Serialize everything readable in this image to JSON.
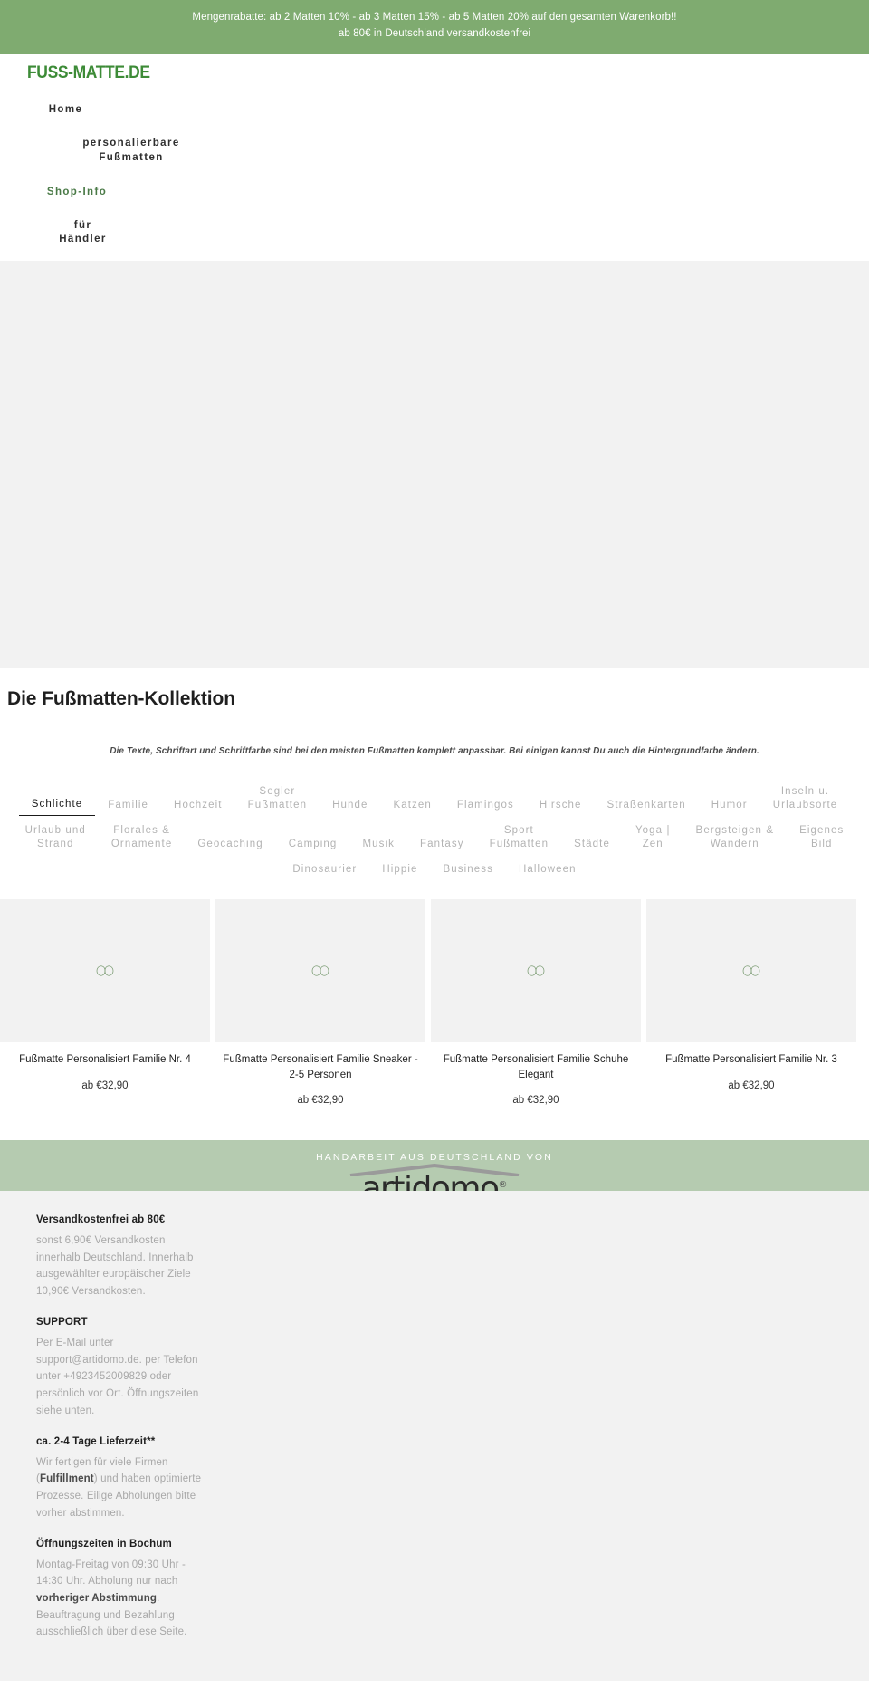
{
  "announcement": {
    "line1": "Mengenrabatte: ab 2 Matten 10% - ab 3 Matten 15% - ab 5 Matten 20% auf den gesamten Warenkorb!!",
    "line2": "ab 80€ in Deutschland versandkostenfrei"
  },
  "header": {
    "logo": "FUSS-MATTE.DE",
    "nav": [
      {
        "line1": "Home",
        "line2": ""
      },
      {
        "line1": "personalierbare",
        "line2": "Fußmatten"
      },
      {
        "line1": "Shop-Info",
        "line2": ""
      },
      {
        "line1": "für",
        "line2": "Händler"
      }
    ]
  },
  "collection": {
    "title": "Die Fußmatten-Kollektion",
    "subtitle": "Die Texte, Schriftart und Schriftfarbe sind bei den meisten Fußmatten komplett anpassbar. Bei einigen kannst Du auch die Hintergrundfarbe ändern.",
    "filters": [
      {
        "label": "Schlichte",
        "active": true
      },
      {
        "label": "Familie",
        "active": false
      },
      {
        "label": "Hochzeit",
        "active": false
      },
      {
        "label": "Segler\nFußmatten",
        "active": false
      },
      {
        "label": "Hunde",
        "active": false
      },
      {
        "label": "Katzen",
        "active": false
      },
      {
        "label": "Flamingos",
        "active": false
      },
      {
        "label": "Hirsche",
        "active": false
      },
      {
        "label": "Straßenkarten",
        "active": false
      },
      {
        "label": "Humor",
        "active": false
      },
      {
        "label": "Inseln u.\nUrlaubsorte",
        "active": false
      },
      {
        "label": "Urlaub und\nStrand",
        "active": false
      },
      {
        "label": "Florales &\nOrnamente",
        "active": false
      },
      {
        "label": "Geocaching",
        "active": false
      },
      {
        "label": "Camping",
        "active": false
      },
      {
        "label": "Musik",
        "active": false
      },
      {
        "label": "Fantasy",
        "active": false
      },
      {
        "label": "Sport\nFußmatten",
        "active": false
      },
      {
        "label": "Städte",
        "active": false
      },
      {
        "label": "Yoga |\nZen",
        "active": false
      },
      {
        "label": "Bergsteigen &\nWandern",
        "active": false
      },
      {
        "label": "Eigenes\nBild",
        "active": false
      },
      {
        "label": "Dinosaurier",
        "active": false
      },
      {
        "label": "Hippie",
        "active": false
      },
      {
        "label": "Business",
        "active": false
      },
      {
        "label": "Halloween",
        "active": false
      }
    ],
    "products": [
      {
        "title": "Fußmatte Personalisiert Familie Nr. 4",
        "price": "ab €32,90",
        "media_icon": "loading-spinner-icon"
      },
      {
        "title": "Fußmatte Personalisiert Familie Sneaker - 2-5 Personen",
        "price": "ab €32,90",
        "media_icon": "loading-spinner-icon"
      },
      {
        "title": "Fußmatte Personalisiert Familie Schuhe Elegant",
        "price": "ab €32,90",
        "media_icon": "loading-spinner-icon"
      },
      {
        "title": "Fußmatte Personalisiert Familie Nr. 3",
        "price": "ab €32,90",
        "media_icon": "loading-spinner-icon"
      }
    ]
  },
  "brand_band": {
    "kicker": "HANDARBEIT AUS DEUTSCHLAND VON",
    "word_part1": "art",
    "word_part2": "i",
    "word_part3": "domo",
    "registered": "®"
  },
  "footer": {
    "blocks": [
      {
        "heading": "Versandkostenfrei ab 80€",
        "body": "sonst 6,90€ Versandkosten innerhalb Deutschland. Innerhalb ausgewählter europäischer Ziele 10,90€ Versandkosten."
      },
      {
        "heading": "SUPPORT",
        "body": "Per E-Mail unter support@artidomo.de. per Telefon unter +4923452009829 oder persönlich vor Ort. Öffnungszeiten siehe unten."
      },
      {
        "heading": "ca. 2-4 Tage Lieferzeit**",
        "body_pre": "Wir fertigen für viele Firmen (",
        "body_bold": "Fulfillment",
        "body_post": ") und haben optimierte Prozesse. Eilige Abholungen bitte vorher abstimmen."
      },
      {
        "heading": "Öffnungszeiten in Bochum",
        "body_pre": "Montag-Freitag von 09:30 Uhr - 14:30 Uhr. Abholung nur nach ",
        "body_bold": "vorheriger Abstimmung",
        "body_post": ". Beauftragung und Bezahlung ausschließlich über diese Seite."
      }
    ]
  },
  "colors": {
    "announce_green": "#7fab70",
    "logo_green": "#3d8b37",
    "band_green": "#b5cbb0",
    "placeholder_gray": "#f2f2f2",
    "spinner_green": "#7a9b72"
  }
}
